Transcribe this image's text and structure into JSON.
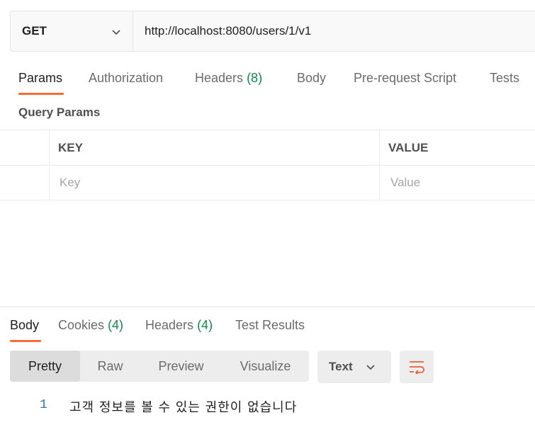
{
  "request": {
    "method": "GET",
    "url": "http://localhost:8080/users/1/v1"
  },
  "request_tabs": {
    "params": "Params",
    "authorization": "Authorization",
    "headers": "Headers",
    "headers_count": "(8)",
    "body": "Body",
    "pre_request": "Pre-request Script",
    "tests": "Tests"
  },
  "query_params": {
    "title": "Query Params",
    "key_header": "KEY",
    "value_header": "VALUE",
    "key_placeholder": "Key",
    "value_placeholder": "Value"
  },
  "response_tabs": {
    "body": "Body",
    "cookies": "Cookies",
    "cookies_count": "(4)",
    "headers": "Headers",
    "headers_count": "(4)",
    "test_results": "Test Results"
  },
  "response_view": {
    "pretty": "Pretty",
    "raw": "Raw",
    "preview": "Preview",
    "visualize": "Visualize",
    "format": "Text"
  },
  "response_body": {
    "line_number": "1",
    "text": "고객 정보를 볼 수 있는 권한이 없습니다"
  },
  "colors": {
    "accent": "#ff6c37",
    "count_green": "#0f8a4a",
    "line_number": "#2a77b8"
  },
  "icons": {
    "method_caret": "chevron-down-icon",
    "format_caret": "chevron-down-icon",
    "wrap": "wrap-lines-icon"
  }
}
